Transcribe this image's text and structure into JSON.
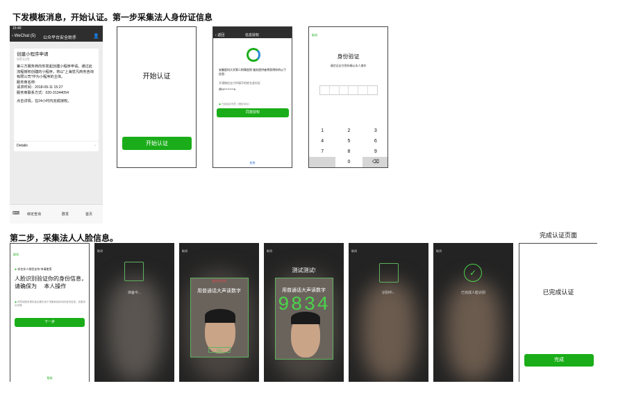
{
  "step1": {
    "title": "下发模板消息，开始认证。第一步采集法人身份证信息",
    "wechat": {
      "time": "15:40",
      "back_label": "WeChat (5)",
      "nav_title": "公众平台安全助手",
      "card_title": "创建小程序申请",
      "card_date": "9月11日",
      "card_body": "第三方服务商向你发起创建小程序申请。通过此流程授权创建的小程序，将以\"上海觉凡商务咨询有限公司\"作为小程序的主体。",
      "merchant_label": "服务商名称:",
      "request_time": "请求时间：2018-09-11 15:27",
      "contact": "服务商联系方式：020-31344054",
      "note": "点击详情，在24小时内完成授权。",
      "details_label": "Details",
      "bottom_tabs": [
        "绑定查询",
        "群发",
        "首页"
      ]
    },
    "start": {
      "title": "开始认证",
      "button": "开始认证"
    },
    "auth": {
      "back": "返回",
      "nav_title": "信息授权",
      "desc": "安徽医科大学第二附属医院 服务提供者将获得你的以下信息：",
      "field_hint": "开通微信支付时填写的姓名身份证",
      "masked_id": "胡*6*********8",
      "agree_text": "已阅读并同意《授权协议》",
      "agree_button": "同意授权",
      "reject": "拒绝"
    },
    "verify": {
      "cancel": "取消",
      "title": "身份验证",
      "hint": "请验证支付密码确认本人操作",
      "keys": [
        [
          "1",
          "2",
          "3"
        ],
        [
          "4",
          "5",
          "6"
        ],
        [
          "7",
          "8",
          "9"
        ],
        [
          "",
          "0",
          "⌫"
        ]
      ]
    }
  },
  "step2": {
    "title": "第二步，采集法人人脸信息。",
    "intro": {
      "cancel": "取消",
      "logo_text": "实名实人校验支持 申请使用",
      "headline": "人脸识别验证你的身份信息，请确保为",
      "headline_person": "本人操作",
      "agree_text": "同意按服务提供者必要仅用于采集和保存你的身份信息。查看协议详情",
      "next_button": "下一步",
      "footer": "帮助"
    },
    "prepare": {
      "cancel": "取消",
      "text": "准备中..."
    },
    "read_digits": {
      "cancel": "取消",
      "warning": "靠近点检测",
      "prompt": "用普通话大声读数字",
      "button": "开始"
    },
    "test": {
      "cancel": "取消",
      "headline": "测试测试!",
      "prompt": "用普通话大声读数字",
      "digits": "9834"
    },
    "recognizing": {
      "cancel": "取消",
      "text": "识别中..."
    },
    "done_face": {
      "cancel": "取消",
      "text": "已完成人脸识别"
    }
  },
  "complete": {
    "caption": "完成认证页面",
    "text": "已完成认证",
    "button": "完成"
  },
  "colors": {
    "accent": "#1aad19",
    "dark": "#232323"
  }
}
